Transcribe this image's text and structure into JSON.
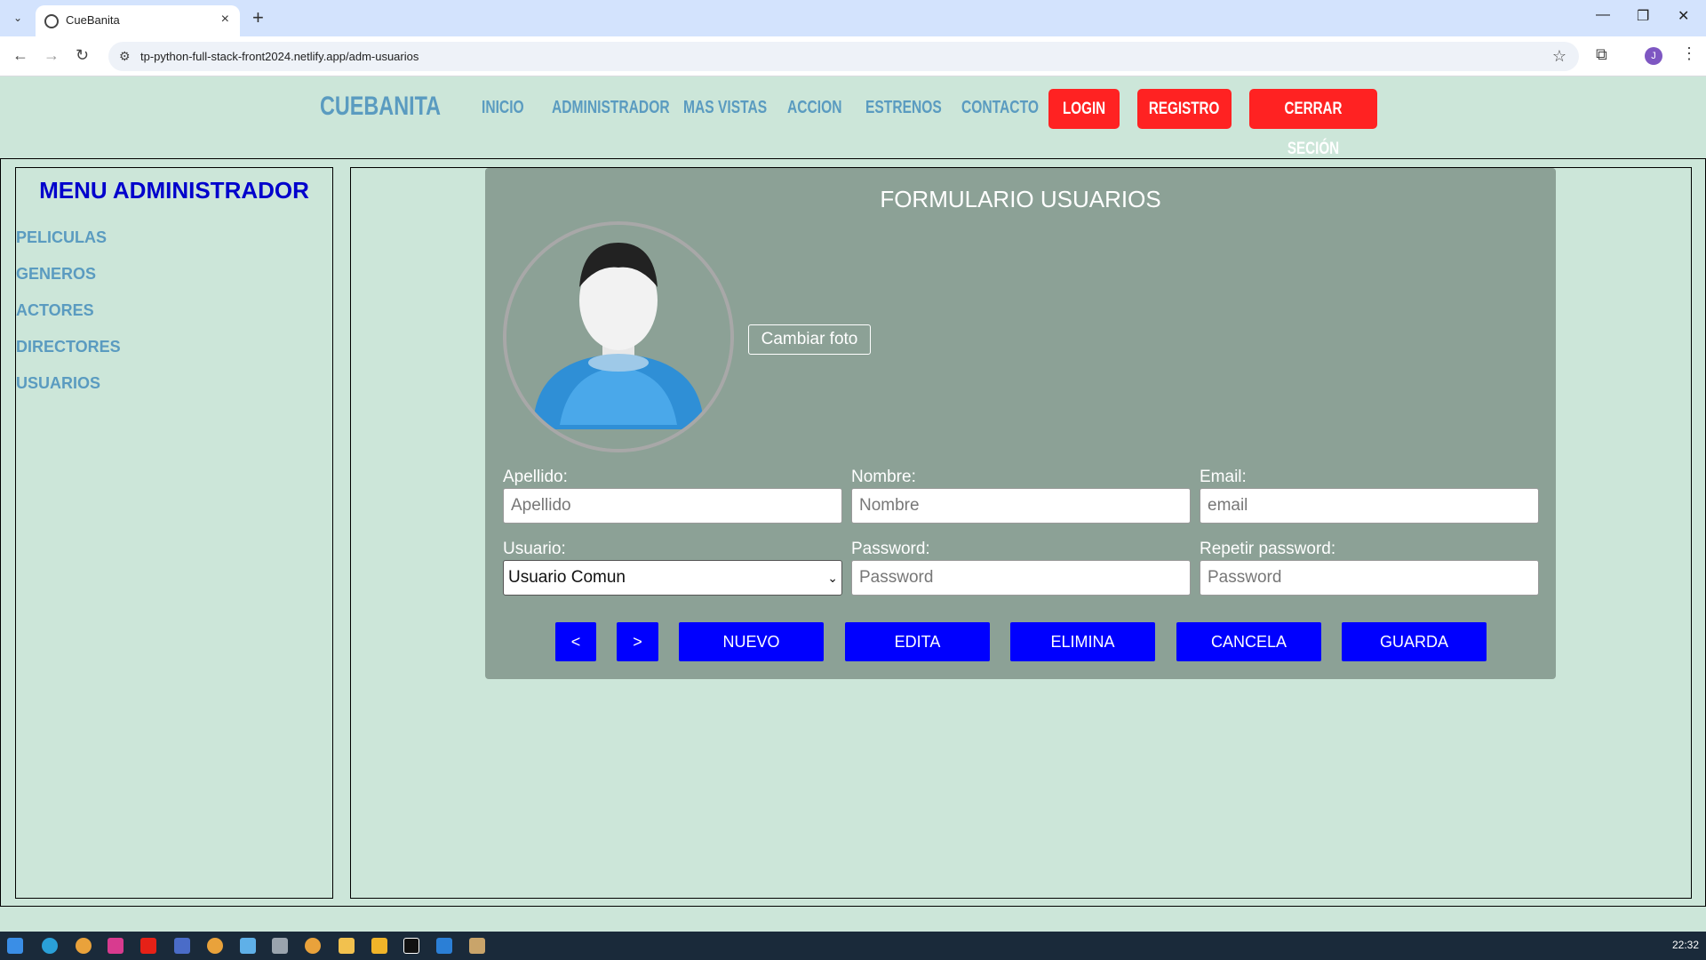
{
  "browser": {
    "tab_title": "CueBanita",
    "url": "tp-python-full-stack-front2024.netlify.app/adm-usuarios",
    "profile_initial": "J"
  },
  "header": {
    "brand": "CUEBANITA",
    "nav": [
      "INICIO",
      "ADMINISTRADOR",
      "MAS VISTAS",
      "ACCION",
      "ESTRENOS",
      "CONTACTO"
    ],
    "login": "LOGIN",
    "registro": "REGISTRO",
    "logout": "CERRAR SECIÓN"
  },
  "sidebar": {
    "title": "MENU ADMINISTRADOR",
    "items": [
      "PELICULAS",
      "GENEROS",
      "ACTORES",
      "DIRECTORES",
      "USUARIOS"
    ]
  },
  "form": {
    "title": "FORMULARIO USUARIOS",
    "change_photo": "Cambiar foto",
    "apellido_label": "Apellido:",
    "apellido_placeholder": "Apellido",
    "nombre_label": "Nombre:",
    "nombre_placeholder": "Nombre",
    "email_label": "Email:",
    "email_placeholder": "email",
    "usuario_label": "Usuario:",
    "usuario_value": "Usuario Comun",
    "password_label": "Password:",
    "password_placeholder": "Password",
    "repeat_label": "Repetir password:",
    "repeat_placeholder": "Password",
    "buttons": {
      "prev": "<",
      "next": ">",
      "nuevo": "NUEVO",
      "edita": "EDITA",
      "elimina": "ELIMINA",
      "cancela": "CANCELA",
      "guarda": "GUARDA"
    }
  },
  "taskbar": {
    "clock": "22:32"
  },
  "colors": {
    "page_bg": "#cce6d9",
    "brand_blue": "#5a9bc0",
    "red_button": "#ff2222",
    "action_blue": "#0000ff",
    "panel_bg": "#8ca196",
    "sidebar_title": "#0000cc"
  }
}
